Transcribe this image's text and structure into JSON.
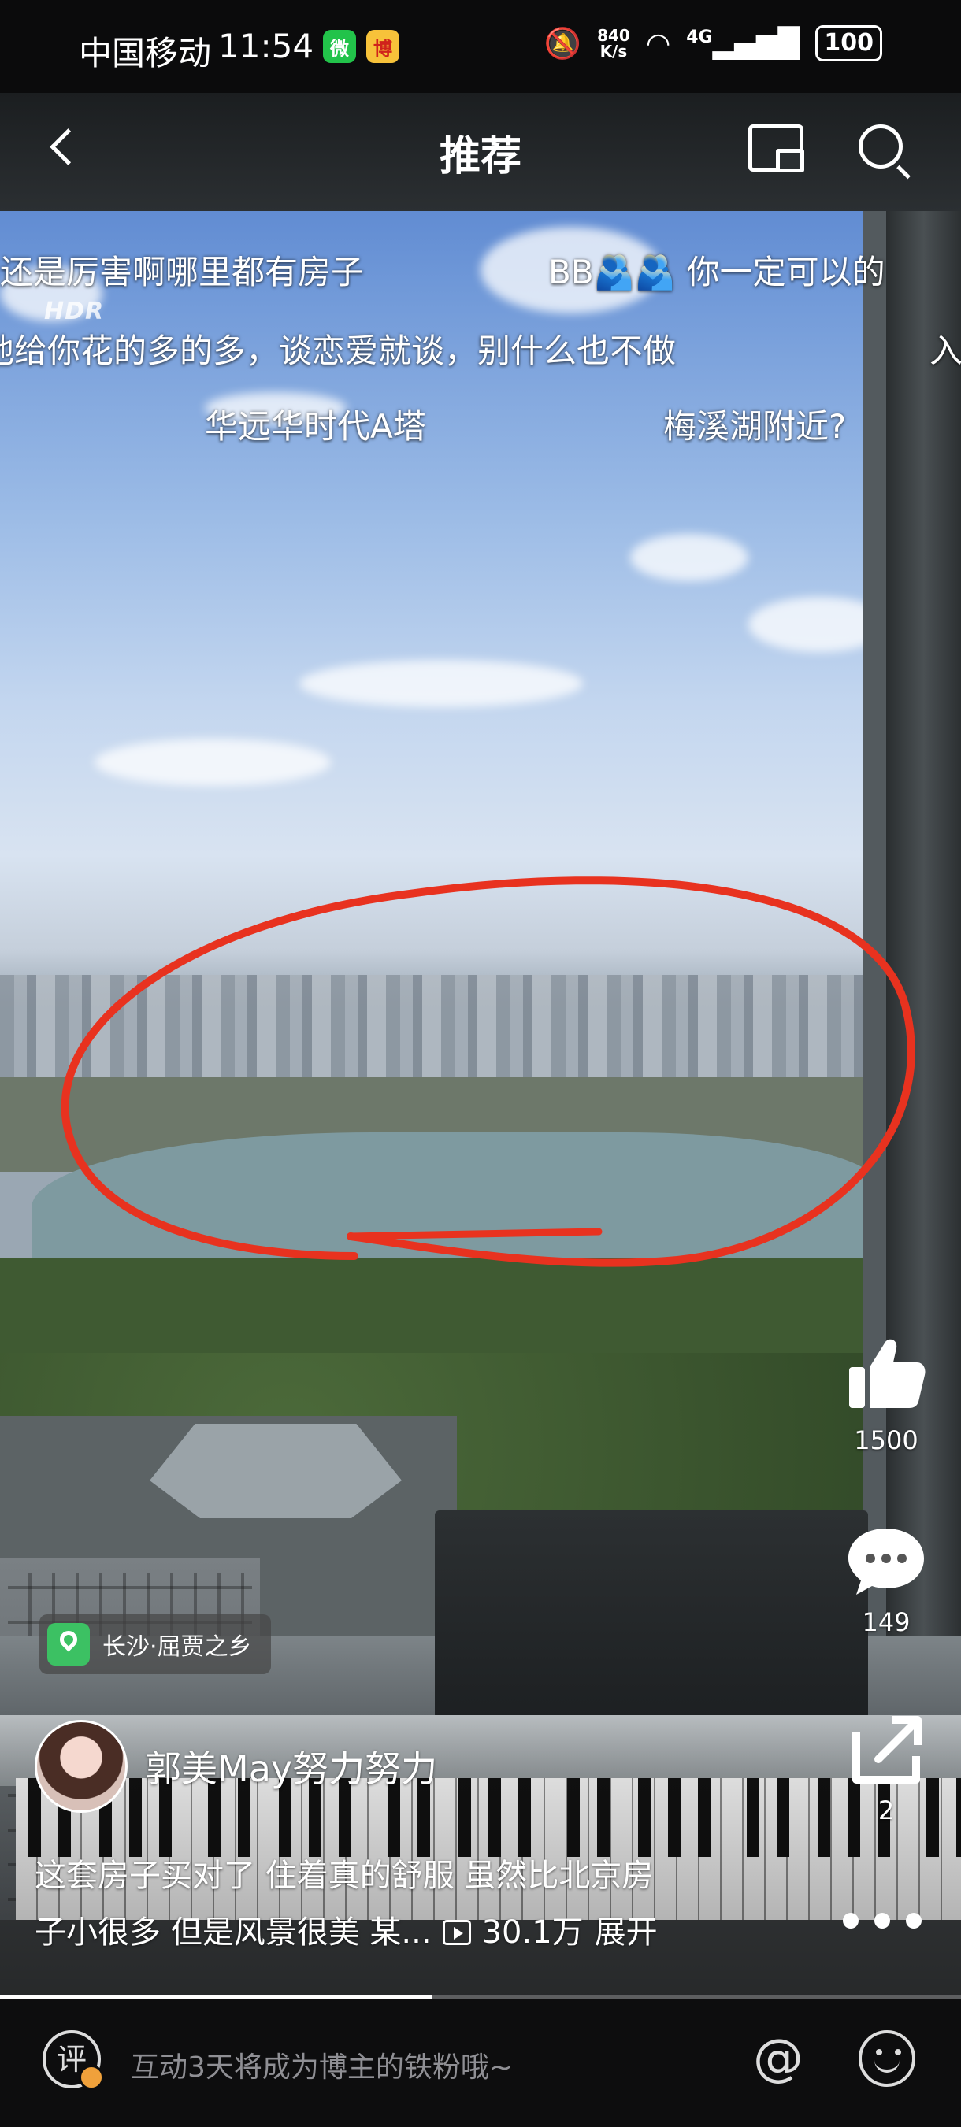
{
  "status_bar": {
    "carrier": "中国移动",
    "time": "11:54",
    "wechat_glyph": "微",
    "weibo_glyph": "博",
    "net_speed_value": "840",
    "net_speed_unit": "K/s",
    "signal": "4G",
    "battery": "100"
  },
  "nav": {
    "title": "推荐"
  },
  "video": {
    "hdr_badge": "HDR",
    "danmaku": [
      "还是厉害啊哪里都有房子",
      "BB🫂🫂  你一定可以的",
      "他给你花的多的多，谈恋爱就谈，别什么也不做",
      "入",
      "华远华时代A塔",
      "梅溪湖附近?"
    ],
    "annotation_color": "#e8321f"
  },
  "actions": {
    "like_count": "1500",
    "comment_count": "149",
    "share_count": "2"
  },
  "location": {
    "label": "长沙·屈贾之乡"
  },
  "author": {
    "name": "郭美May努力努力"
  },
  "description": {
    "line1": "这套房子买对了 住着真的舒服 虽然比北京房",
    "line2": "子小很多 但是风景很美 某...",
    "views": "30.1万",
    "expand": "展开"
  },
  "playback": {
    "progress": 0.45
  },
  "bottom_bar": {
    "ping_glyph": "评",
    "comment_placeholder": "互动3天将成为博主的铁粉哦~",
    "at_symbol": "@"
  },
  "colors": {
    "accent_location": "#3cc163",
    "annotation": "#e8321f",
    "badge_orange": "#f0a13b"
  }
}
